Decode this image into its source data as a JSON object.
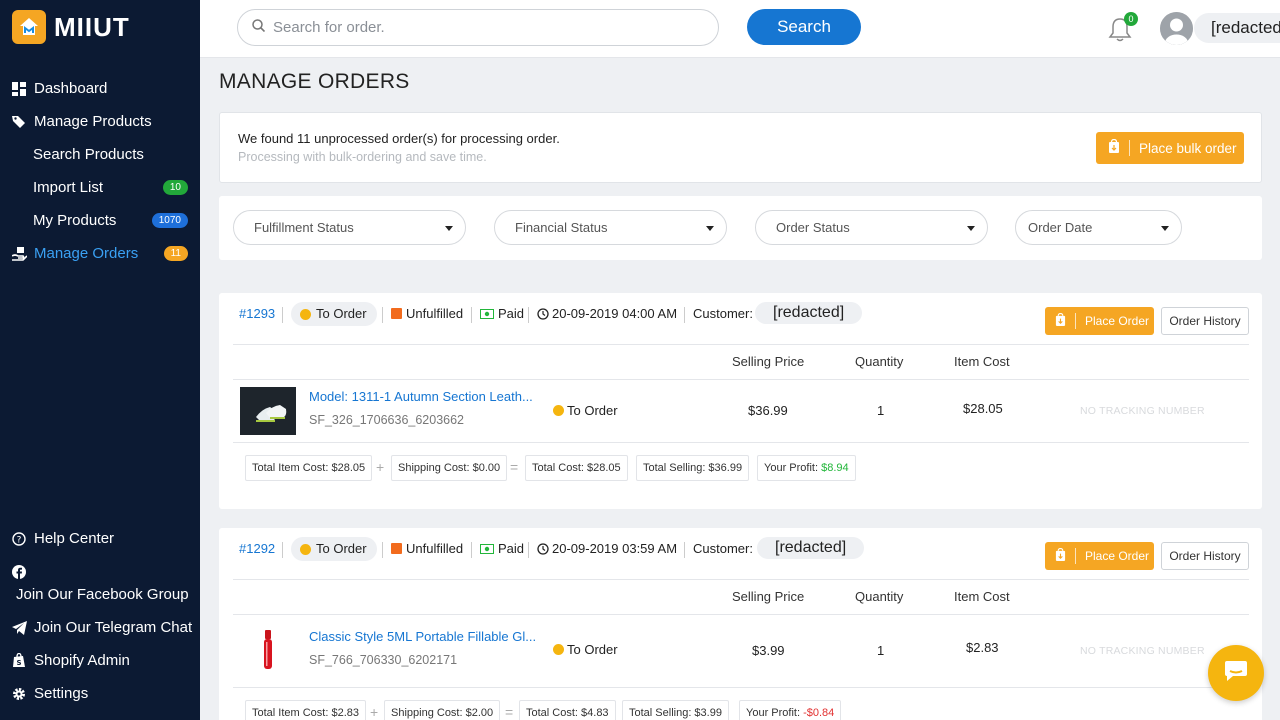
{
  "brand": {
    "name": "MIIUT"
  },
  "sidebar": {
    "items": [
      {
        "label": "Dashboard",
        "icon": "dashboard-icon"
      },
      {
        "label": "Manage Products",
        "icon": "tag-icon"
      },
      {
        "label": "Search Products"
      },
      {
        "label": "Import List",
        "badge": "10"
      },
      {
        "label": "My Products",
        "badge": "1070"
      },
      {
        "label": "Manage Orders",
        "icon": "hand-box-icon",
        "badge": "11",
        "active": true
      }
    ],
    "bottom": [
      {
        "label": "Help Center",
        "icon": "help-icon"
      },
      {
        "label": "Join Our Facebook Group",
        "icon": "facebook-icon"
      },
      {
        "label": "Join Our Telegram Chat",
        "icon": "telegram-icon"
      },
      {
        "label": "Shopify Admin",
        "icon": "shopify-icon"
      },
      {
        "label": "Settings",
        "icon": "gear-icon"
      }
    ]
  },
  "header": {
    "search_placeholder": "Search for order.",
    "search_button": "Search",
    "notification_count": "0",
    "user_name": "[redacted]"
  },
  "page": {
    "title": "MANAGE ORDERS",
    "notice_main": "We found 11 unprocessed order(s) for processing order.",
    "notice_sub": "Processing with bulk-ordering and save time.",
    "bulk_button": "Place bulk order"
  },
  "filters": [
    "Fulfillment Status",
    "Financial Status",
    "Order Status",
    "Order Date"
  ],
  "columns": {
    "selling_price": "Selling Price",
    "quantity": "Quantity",
    "item_cost": "Item Cost"
  },
  "labels": {
    "customer": "Customer:",
    "place_order": "Place Order",
    "order_history": "Order History",
    "no_tracking": "NO TRACKING NUMBER"
  },
  "orders": [
    {
      "id": "#1293",
      "status": "To Order",
      "fulfillment": "Unfulfilled",
      "financial": "Paid",
      "date": "20-09-2019 04:00 AM",
      "customer": "[redacted]",
      "item": {
        "name": "Model: 1311-1 Autumn Section Leath...",
        "sku": "SF_326_1706636_6203662",
        "status": "To Order",
        "selling_price": "$36.99",
        "quantity": "1",
        "item_cost": "$28.05"
      },
      "summary": {
        "total_item_cost": "Total Item Cost: $28.05",
        "shipping_cost": "Shipping Cost: $0.00",
        "total_cost": "Total Cost: $28.05",
        "total_selling": "Total Selling: $36.99",
        "profit_label": "Your Profit: ",
        "profit_value": "$8.94"
      }
    },
    {
      "id": "#1292",
      "status": "To Order",
      "fulfillment": "Unfulfilled",
      "financial": "Paid",
      "date": "20-09-2019 03:59 AM",
      "customer": "[redacted]",
      "item": {
        "name": "Classic Style 5ML Portable Fillable Gl...",
        "sku": "SF_766_706330_6202171",
        "status": "To Order",
        "selling_price": "$3.99",
        "quantity": "1",
        "item_cost": "$2.83"
      },
      "summary": {
        "total_item_cost": "Total Item Cost: $2.83",
        "shipping_cost": "Shipping Cost: $2.00",
        "total_cost": "Total Cost: $4.83",
        "total_selling": "Total Selling: $3.99",
        "profit_label": "Your Profit: ",
        "profit_value": "-$0.84"
      }
    }
  ],
  "colors": {
    "sidebar_bg": "#0c1a33",
    "accent_blue": "#1676d2",
    "accent_orange": "#f5a623",
    "profit_positive": "#22b63a",
    "profit_negative": "#e23030"
  }
}
